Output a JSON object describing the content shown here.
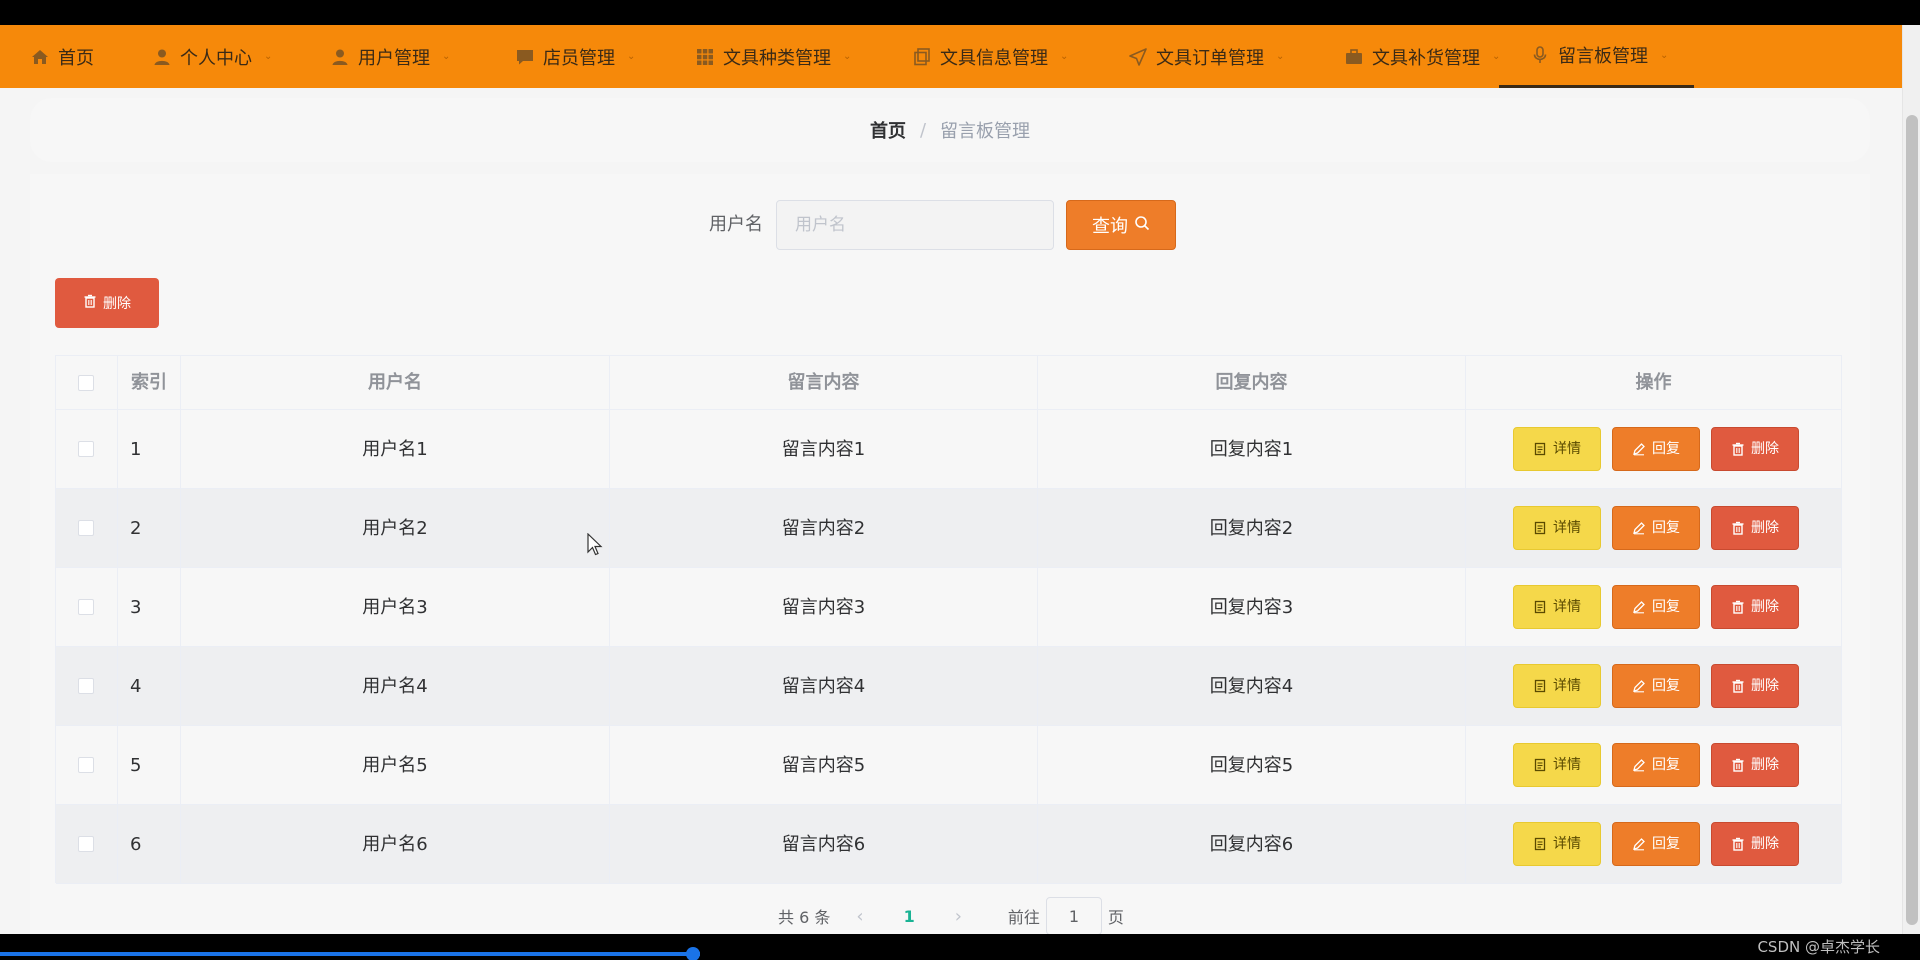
{
  "nav": {
    "items": [
      {
        "label": "首页",
        "icon": "home-icon",
        "dropdown": false
      },
      {
        "label": "个人中心",
        "icon": "user-icon",
        "dropdown": true
      },
      {
        "label": "用户管理",
        "icon": "user-icon",
        "dropdown": true
      },
      {
        "label": "店员管理",
        "icon": "chat-icon",
        "dropdown": true
      },
      {
        "label": "文具种类管理",
        "icon": "grid-icon",
        "dropdown": true
      },
      {
        "label": "文具信息管理",
        "icon": "copy-icon",
        "dropdown": true
      },
      {
        "label": "文具订单管理",
        "icon": "send-icon",
        "dropdown": true
      },
      {
        "label": "文具补货管理",
        "icon": "briefcase-icon",
        "dropdown": true
      },
      {
        "label": "留言板管理",
        "icon": "microphone-icon",
        "dropdown": true,
        "active": true
      }
    ],
    "chevron": "⌄"
  },
  "breadcrumb": {
    "home": "首页",
    "separator": "/",
    "current": "留言板管理"
  },
  "search": {
    "label": "用户名",
    "placeholder": "用户名",
    "value": "",
    "button_label": "查询"
  },
  "toolbar": {
    "delete_label": "删除"
  },
  "table": {
    "headers": {
      "index": "索引",
      "username": "用户名",
      "message": "留言内容",
      "reply": "回复内容",
      "actions": "操作"
    },
    "rows": [
      {
        "index": "1",
        "username": "用户名1",
        "message": "留言内容1",
        "reply": "回复内容1"
      },
      {
        "index": "2",
        "username": "用户名2",
        "message": "留言内容2",
        "reply": "回复内容2"
      },
      {
        "index": "3",
        "username": "用户名3",
        "message": "留言内容3",
        "reply": "回复内容3"
      },
      {
        "index": "4",
        "username": "用户名4",
        "message": "留言内容4",
        "reply": "回复内容4"
      },
      {
        "index": "5",
        "username": "用户名5",
        "message": "留言内容5",
        "reply": "回复内容5"
      },
      {
        "index": "6",
        "username": "用户名6",
        "message": "留言内容6",
        "reply": "回复内容6"
      }
    ],
    "actions": {
      "detail": "详情",
      "reply": "回复",
      "delete": "删除"
    }
  },
  "pagination": {
    "total": "共 6 条",
    "current_page": "1",
    "goto_label": "前往",
    "goto_value": "1",
    "page_unit": "页",
    "prev": "‹",
    "next": "›"
  },
  "watermark": "CSDN @卓杰学长",
  "colors": {
    "nav_bg": "#f6890a",
    "primary": "#ee7d29",
    "danger": "#e05a3f",
    "warning": "#f5d84a",
    "page_active": "#1ab394"
  }
}
